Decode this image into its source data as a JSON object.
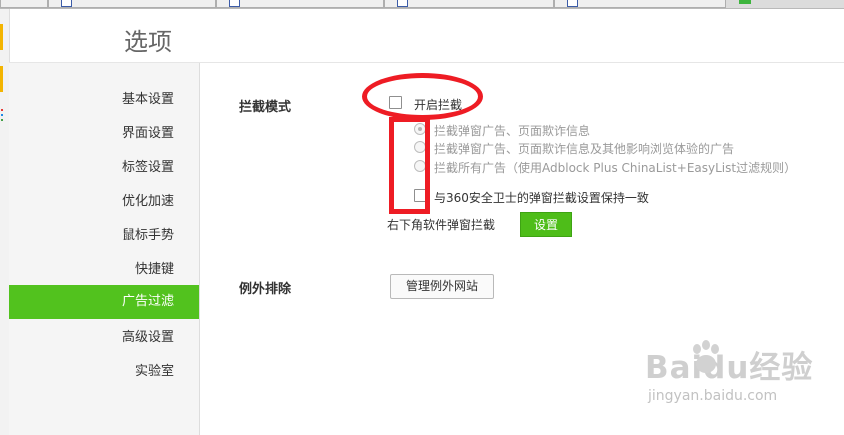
{
  "page": {
    "title": "选项"
  },
  "sidebar": {
    "items": [
      {
        "label": "基本设置"
      },
      {
        "label": "界面设置"
      },
      {
        "label": "标签设置"
      },
      {
        "label": "优化加速"
      },
      {
        "label": "鼠标手势"
      },
      {
        "label": "快捷键"
      },
      {
        "label": "广告过滤",
        "active": true
      },
      {
        "label": "高级设置"
      },
      {
        "label": "实验室"
      }
    ]
  },
  "blocking": {
    "section_label": "拦截模式",
    "enable_label": "开启拦截",
    "enable_checked": false,
    "modes": [
      {
        "label": "拦截弹窗广告、页面欺诈信息",
        "selected": true
      },
      {
        "label": "拦截弹窗广告、页面欺诈信息及其他影响浏览体验的广告",
        "selected": false
      },
      {
        "label": "拦截所有广告（使用Adblock Plus ChinaList+EasyList过滤规则）",
        "selected": false
      }
    ],
    "sync_label": "与360安全卫士的弹窗拦截设置保持一致",
    "sync_checked": false,
    "popup_label": "右下角软件弹窗拦截",
    "settings_button": "设置"
  },
  "exceptions": {
    "section_label": "例外排除",
    "manage_button": "管理例外网站"
  },
  "watermark": {
    "logo": "Baidu经验",
    "url": "jingyan.baidu.com"
  },
  "colors": {
    "accent": "#52c21e",
    "annotation": "#ee1c24"
  }
}
